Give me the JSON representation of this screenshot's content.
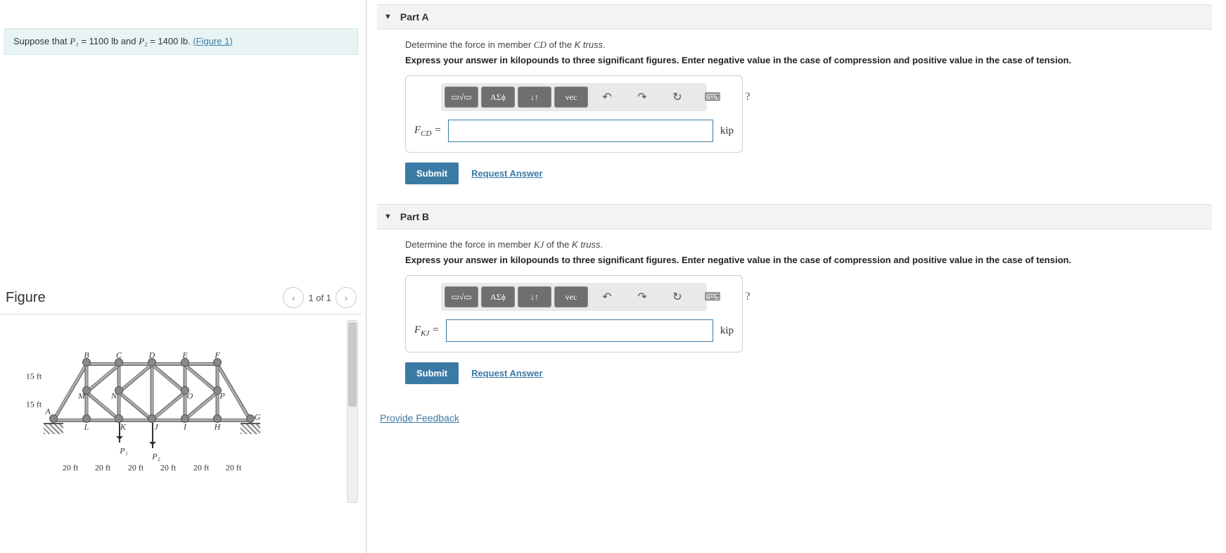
{
  "prompt": {
    "prefix": "Suppose that ",
    "p1_sym": "P₁",
    "p1_val": " = 1100 lb",
    "and": " and ",
    "p2_sym": "P₂",
    "p2_val": " = 1400 lb",
    "suffix": ". ",
    "fig_link": "(Figure 1)"
  },
  "figure": {
    "heading": "Figure",
    "pager": "1 of 1",
    "labels": {
      "A": "A",
      "B": "B",
      "C": "C",
      "D": "D",
      "E": "E",
      "F": "F",
      "G": "G",
      "H": "H",
      "I": "I",
      "J": "J",
      "K": "K",
      "L": "L",
      "M": "M",
      "N": "N",
      "O": "O",
      "P": "P",
      "P1": "P₁",
      "P2": "P₂",
      "h1": "15 ft",
      "h2": "15 ft",
      "w": "20 ft"
    }
  },
  "partA": {
    "title": "Part A",
    "question_pre": "Determine the force in member ",
    "member": "CD",
    "question_post": " of the ",
    "truss": "K truss",
    "period": ".",
    "hint": "Express your answer in kilopounds to three significant figures. Enter negative value in the case of compression and positive value in the case of tension.",
    "var": "F_CD",
    "eq": " =",
    "unit": "kip",
    "submit": "Submit",
    "request": "Request Answer"
  },
  "partB": {
    "title": "Part B",
    "question_pre": "Determine the force in member ",
    "member": "KJ",
    "question_post": " of the ",
    "truss": "K truss",
    "period": ".",
    "hint": "Express your answer in kilopounds to three significant figures. Enter negative value in the case of compression and positive value in the case of tension.",
    "var": "F_KJ",
    "eq": " =",
    "unit": "kip",
    "submit": "Submit",
    "request": "Request Answer"
  },
  "toolbar": {
    "tmpl": "▭√▭",
    "greek": "ΑΣϕ",
    "swap": "↓↑",
    "vec": "vec",
    "undo": "↶",
    "redo": "↷",
    "reset": "↻",
    "kbd": "⌨",
    "help": "?"
  },
  "feedback": "Provide Feedback"
}
